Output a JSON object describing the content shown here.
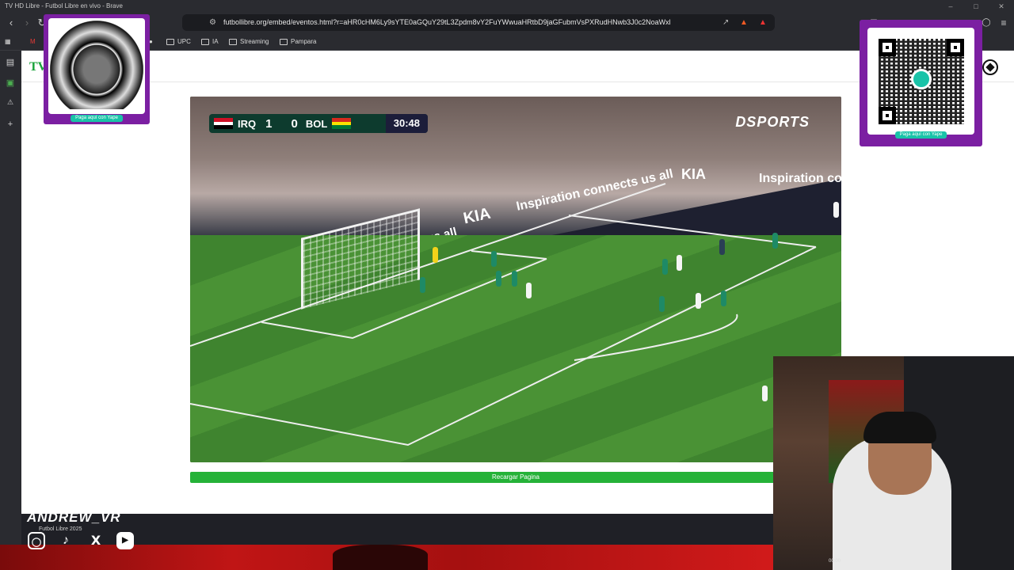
{
  "window": {
    "title": "TV HD Libre - Futbol Libre en vivo - Brave"
  },
  "toolbar": {
    "url": "futbollibre.org/embed/eventos.html?r=aHR0cHM6Ly9sYTE0aGQuY29tL3Zpdm8vY2FuYWwuaHRtbD9jaGFubmVsPXRudHNwb3J0c2NoaWxl"
  },
  "bookmarks": [
    "UPC",
    "IA",
    "Streaming",
    "Pampara"
  ],
  "site": {
    "logo": "TV"
  },
  "scoreboard": {
    "team_home": "IRQ",
    "score_home": "1",
    "score_away": "0",
    "team_away": "BOL",
    "clock": "30:48",
    "broadcaster": "DSPORTS"
  },
  "ads": {
    "board_text": "Inspiration connects us all",
    "brand": "KIA"
  },
  "reload_button": "Recargar Pagina",
  "qr_left": {
    "caption": "Paga aquí con Yape"
  },
  "qr_right": {
    "caption": "Paga aquí con Yape"
  },
  "footer": {
    "text": "Futbol Libre 2025"
  },
  "streamer": {
    "name": "ANDREW_VR"
  },
  "webcam": {
    "timestamp": "00:00"
  },
  "colors": {
    "accent": "#25b238",
    "yape_purple": "#7b1fa2",
    "scorebug": "#0d3b2e"
  },
  "social_icons": [
    "instagram-icon",
    "tiktok-icon",
    "x-icon",
    "youtube-icon"
  ]
}
